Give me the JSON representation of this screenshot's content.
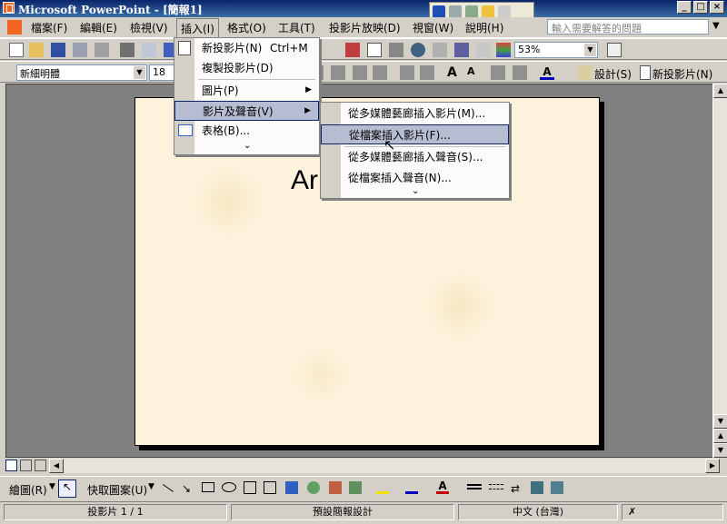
{
  "window": {
    "title": "Microsoft PowerPoint - [簡報1]"
  },
  "menubar": {
    "items": [
      "檔案(F)",
      "編輯(E)",
      "檢視(V)",
      "插入(I)",
      "格式(O)",
      "工具(T)",
      "投影片放映(D)",
      "視窗(W)",
      "說明(H)"
    ],
    "help_placeholder": "輸入需要解答的問題"
  },
  "toolbar1": {
    "zoom": "53%"
  },
  "toolbar2": {
    "font": "新細明體",
    "size": "18",
    "design_label": "設計(S)",
    "new_slide_label": "新投影片(N)"
  },
  "insert_menu": {
    "items": [
      {
        "label": "新投影片(N)",
        "shortcut": "Ctrl+M"
      },
      {
        "label": "複製投影片(D)"
      },
      {
        "label": "圖片(P)"
      },
      {
        "label": "影片及聲音(V)"
      },
      {
        "label": "表格(B)..."
      }
    ]
  },
  "media_submenu": {
    "items": [
      "從多媒體藝廊插入影片(M)...",
      "從檔案插入影片(F)...",
      "從多媒體藝廊插入聲音(S)...",
      "從檔案插入聲音(N)..."
    ]
  },
  "slide": {
    "title_fragment": "Ar"
  },
  "drawbar": {
    "draw_label": "繪圖(R)",
    "autoshapes_label": "快取圖案(U)"
  },
  "status": {
    "slide": "投影片 1 / 1",
    "design": "預設簡報設計",
    "language": "中文 (台灣)"
  }
}
